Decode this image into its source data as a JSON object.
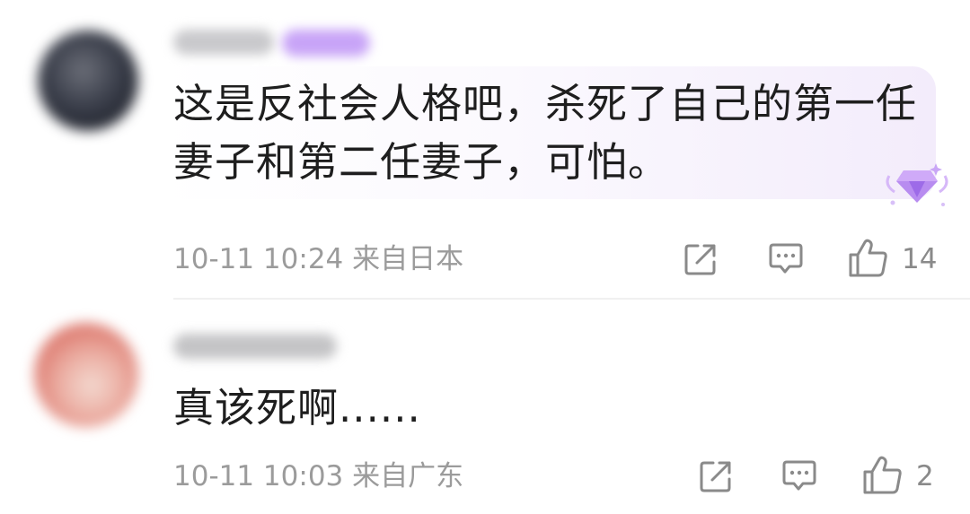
{
  "comments": [
    {
      "content_line1": "这是反社会人格吧，杀死了自己的第一任",
      "content_line2": "妻子和第二任妻子，可怕。",
      "meta": "10-11 10:24 来自日本",
      "like_count": "14",
      "has_bubble": true,
      "avatar_color": "#3a3e4a",
      "username_blurred": true,
      "vip_badge_color": "#c8a4f7"
    },
    {
      "content_line1": "真该死啊......",
      "meta": "10-11 10:03 来自广东",
      "like_count": "2",
      "has_bubble": false,
      "avatar_color": "#e8a49a",
      "username_blurred": true
    }
  ],
  "icons": {
    "share": "share-icon",
    "reply": "reply-icon",
    "like": "thumbs-up-icon",
    "bubble_decoration": "diamond-badge-icon"
  },
  "colors": {
    "text": "#1e1e1e",
    "meta": "#9b9b9b",
    "icon": "#8a8a8a",
    "bubble_accent": "#f3ecfb",
    "badge": "#b88cf0"
  }
}
